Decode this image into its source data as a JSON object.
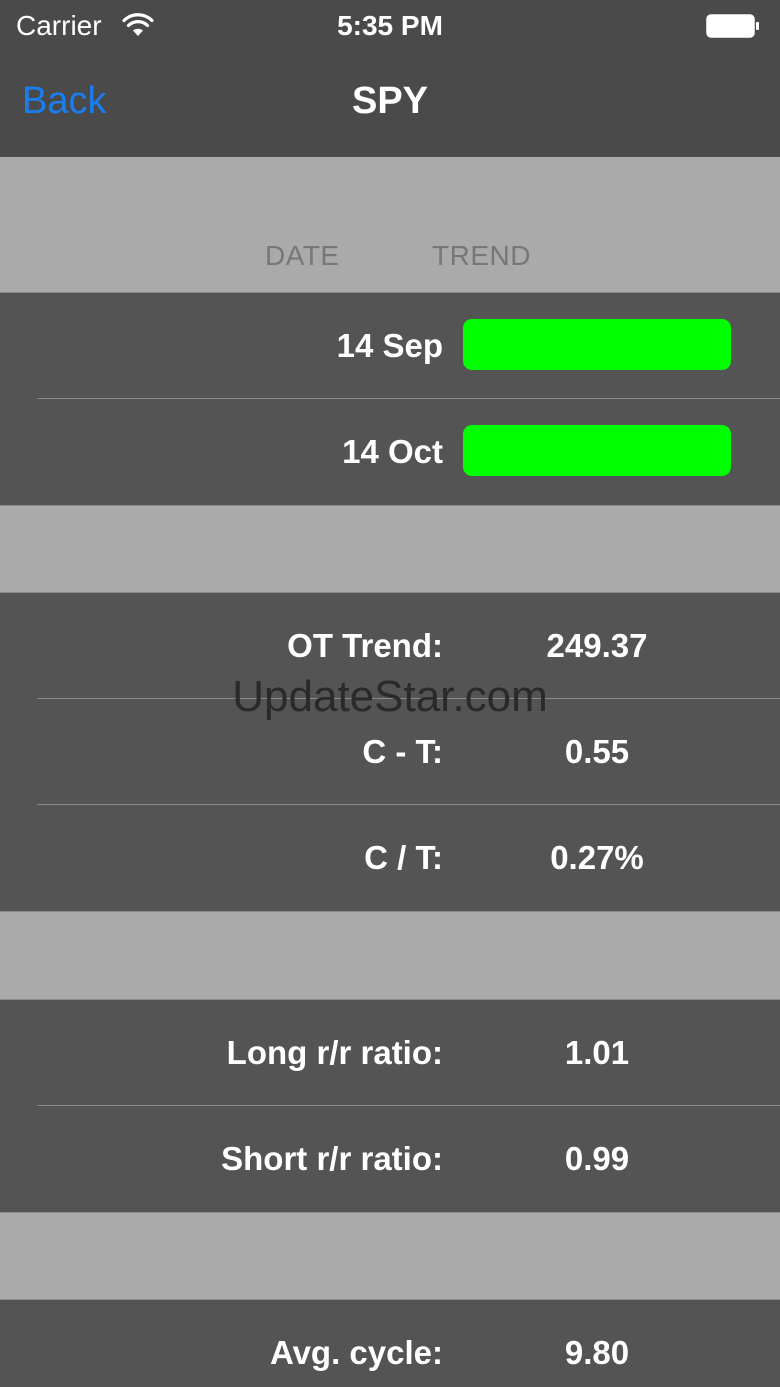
{
  "status_bar": {
    "carrier": "Carrier",
    "time": "5:35 PM",
    "wifi_icon": "wifi-icon",
    "battery_icon": "battery-full-icon"
  },
  "nav": {
    "back_label": "Back",
    "title": "SPY",
    "back_color": "#1a7ef2"
  },
  "table_header": {
    "date": "DATE",
    "trend": "TREND"
  },
  "trend_rows": [
    {
      "date": "14 Sep",
      "trend_color": "#00ff00"
    },
    {
      "date": "14 Oct",
      "trend_color": "#00ff00"
    }
  ],
  "metrics": [
    {
      "label": "OT Trend:",
      "value": "249.37"
    },
    {
      "label": "C - T:",
      "value": "0.55"
    },
    {
      "label": "C / T:",
      "value": "0.27%"
    }
  ],
  "ratios": [
    {
      "label": "Long r/r ratio:",
      "value": "1.01"
    },
    {
      "label": "Short r/r ratio:",
      "value": "0.99"
    }
  ],
  "cycle": [
    {
      "label": "Avg. cycle:",
      "value": "9.80"
    }
  ],
  "watermark": "UpdateStar.com"
}
